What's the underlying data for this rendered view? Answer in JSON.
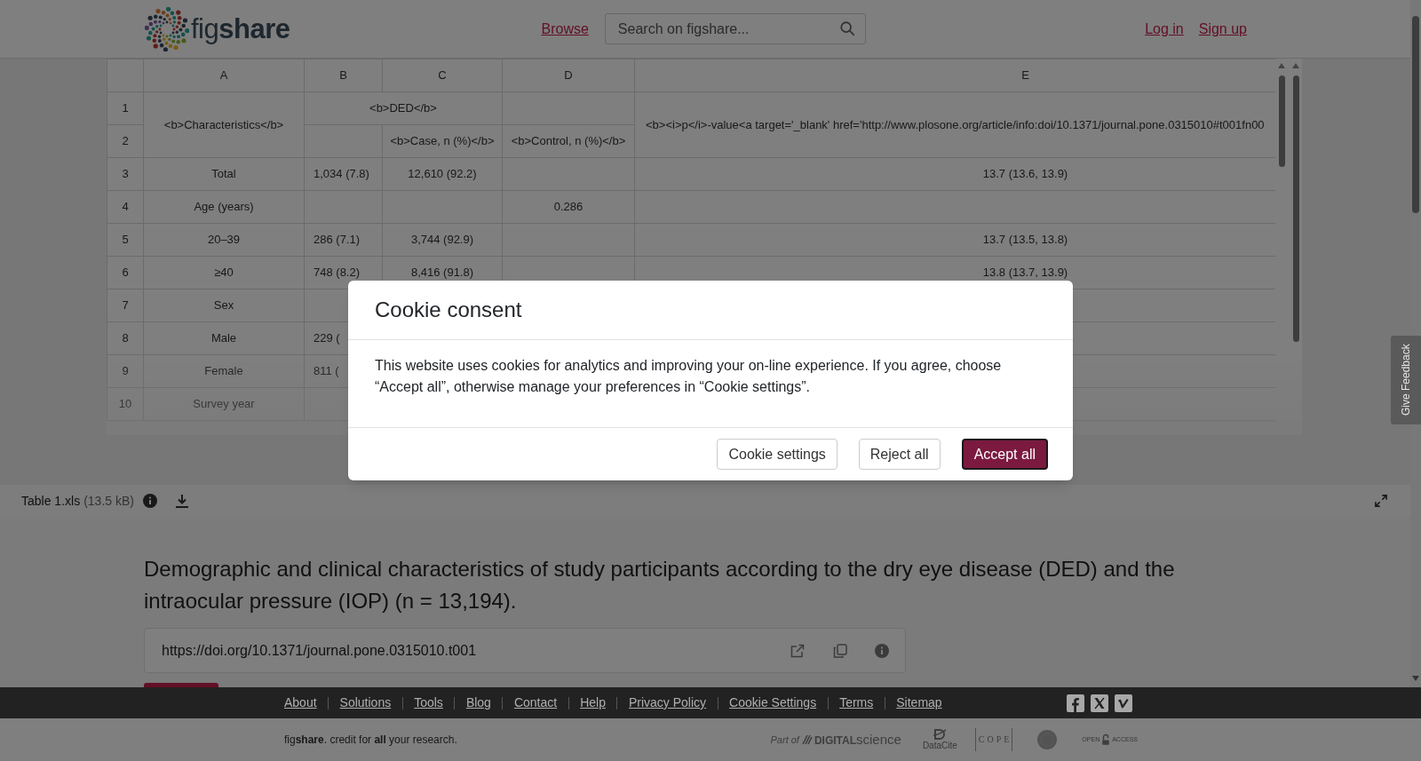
{
  "header": {
    "logo_text": "fig**share**",
    "browse_link": "Browse",
    "search": {
      "placeholder": "Search on figshare..."
    },
    "account_links": [
      "Log in",
      "Sign up"
    ]
  },
  "spreadsheet": {
    "columns": [
      "A",
      "B",
      "C",
      "D",
      "E"
    ],
    "header_block": {
      "row_numbers": [
        "1",
        "2"
      ],
      "characteristics": "<b>Characteristics</b>",
      "ded": "<b>DED</b>",
      "case": "<b>Case, n (%)</b>",
      "control": "<b>Control, n (%)</b>",
      "p_value": "<b><i>p</i>-value<a target='_blank' href='http://www.plosone.org/article/info:doi/10.1371/journal.pone.0315010#t001fn00"
    },
    "rows": [
      {
        "number": "3",
        "a": "Total",
        "b": "1,034 (7.8)",
        "c": "12,610 (92.2)",
        "e": "13.7 (13.6, 13.9)"
      },
      {
        "number": "4",
        "a": "Age (years)",
        "d": "0.286"
      },
      {
        "number": "5",
        "a": "20–39",
        "b": "286 (7.1)",
        "c": "3,744 (92.9)",
        "e": "13.7 (13.5, 13.8)"
      },
      {
        "number": "6",
        "a": "≥40",
        "b": "748 (8.2)",
        "c": "8,416 (91.8)",
        "e": "13.8 (13.7, 13.9)"
      },
      {
        "number": "7",
        "a": "Sex"
      },
      {
        "number": "8",
        "a": "Male",
        "b": "229 ("
      },
      {
        "number": "9",
        "a": "Female",
        "b": "811 ("
      },
      {
        "number": "10",
        "a": "Survey year"
      }
    ]
  },
  "feedback_tab": {
    "label": "Give Feedback"
  },
  "file_bar": {
    "name": "Table 1.xls",
    "size": "(13.5 kB)"
  },
  "title": "Demographic and clinical characteristics of study participants according to the dry eye disease (DED) and the intraocular pressure (IOP) (n = 13,194).",
  "doi": {
    "url": "https://doi.org/10.1371/journal.pone.0315010.t001"
  },
  "footer": {
    "links": [
      "About",
      "Solutions",
      "Tools",
      "Blog",
      "Contact",
      "Help",
      "Privacy Policy",
      "Cookie Settings",
      "Terms",
      "Sitemap"
    ],
    "tagline": "fig**share**. credit for **all** your research.",
    "partners": [
      {
        "kind": "digital_science",
        "lead": "Part of",
        "name": "**DIGITAL**science"
      },
      {
        "kind": "datacite",
        "label": "DataCite"
      },
      {
        "kind": "cope",
        "label": "COPE"
      },
      {
        "kind": "seal"
      },
      {
        "kind": "open_access",
        "lead": "OPEN",
        "tail": "ACCESS"
      }
    ]
  },
  "cookie_dialog": {
    "title": "Cookie consent",
    "message": "This website uses cookies for analytics and improving your on-line experience. If you agree, choose “Accept all”, otherwise manage your preferences in “Cookie settings”.",
    "buttons": [
      {
        "label": "Cookie settings",
        "kind": "settings"
      },
      {
        "label": "Reject all",
        "kind": "reject"
      },
      {
        "label": "Accept all",
        "kind": "accept"
      }
    ]
  }
}
